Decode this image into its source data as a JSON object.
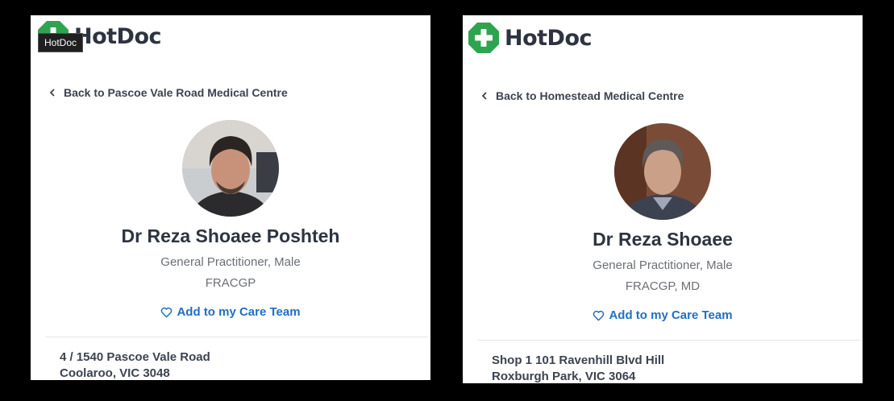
{
  "colors": {
    "brand_green": "#2ea44f",
    "link_blue": "#1f6fc4",
    "heading": "#2d3440",
    "muted": "#6b6f75"
  },
  "left": {
    "logo_text": "HotDoc",
    "tooltip": "HotDoc",
    "back_link": "Back to Pascoe Vale Road Medical Centre",
    "doctor_name": "Dr Reza Shoaee Poshteh",
    "role": "General Practitioner, Male",
    "qualifications": "FRACGP",
    "care_team_label": "Add to my Care Team",
    "address_line1": "4 / 1540 Pascoe Vale Road",
    "address_line2": "Coolaroo, VIC 3048",
    "icons": {
      "logo": "hotdoc-cross-icon",
      "back": "chevron-left-icon",
      "care": "heart-outline-icon"
    }
  },
  "right": {
    "logo_text": "HotDoc",
    "back_link": "Back to Homestead Medical Centre",
    "doctor_name": "Dr Reza Shoaee",
    "role": "General Practitioner, Male",
    "qualifications": "FRACGP, MD",
    "care_team_label": "Add to my Care Team",
    "address_line1": "Shop 1 101 Ravenhill Blvd Hill",
    "address_line2": "Roxburgh Park, VIC 3064",
    "icons": {
      "logo": "hotdoc-cross-icon",
      "back": "chevron-left-icon",
      "care": "heart-outline-icon"
    }
  }
}
